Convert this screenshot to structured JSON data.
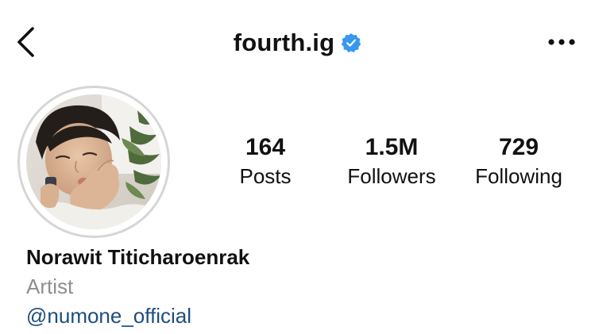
{
  "header": {
    "username": "fourth.ig",
    "verified": true,
    "verified_color": "#3897f0",
    "back_icon": "chevron-left-icon",
    "more_icon": "more-horizontal-icon"
  },
  "profile": {
    "avatar_icon": "profile-photo",
    "stats": [
      {
        "value": "164",
        "label": "Posts"
      },
      {
        "value": "1.5M",
        "label": "Followers"
      },
      {
        "value": "729",
        "label": "Following"
      }
    ],
    "full_name": "Norawit Titicharoenrak",
    "category": "Artist",
    "mention": "@numone_official",
    "mention_color": "#1e4e7c"
  }
}
